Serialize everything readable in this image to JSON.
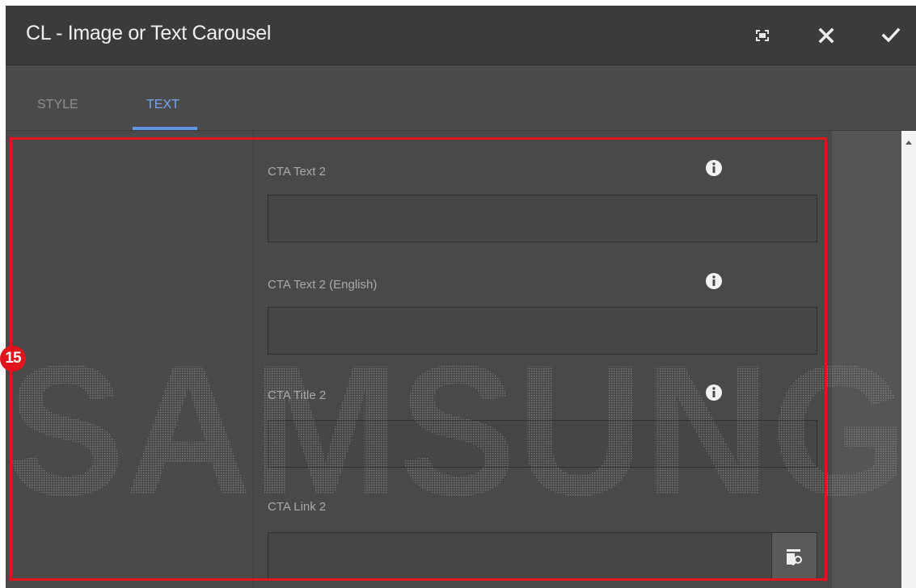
{
  "dialog": {
    "title": "CL - Image or Text Carousel",
    "buttons": [
      {
        "name": "fullscreen",
        "icon": "fullscreen-icon"
      },
      {
        "name": "close",
        "icon": "close-icon"
      },
      {
        "name": "done",
        "icon": "checkmark-icon"
      }
    ]
  },
  "tabs": [
    {
      "label": "STYLE",
      "active": false
    },
    {
      "label": "TEXT",
      "active": true
    }
  ],
  "fields": [
    {
      "label": "CTA Text 2",
      "value": "",
      "icon": "info-icon"
    },
    {
      "label": "CTA Text 2 (English)",
      "value": "",
      "icon": "info-icon"
    },
    {
      "label": "CTA Title 2",
      "value": "",
      "icon": "info-icon"
    },
    {
      "label": "CTA Link 2",
      "value": "",
      "action_icon": "path-browser-icon"
    }
  ],
  "annotation": {
    "badge": "15",
    "highlight_color": "#e0161e"
  },
  "watermark": {
    "text": "SAMSUNG"
  },
  "colors": {
    "accent": "#5f95e6",
    "active_tab_text": "#78a6ec",
    "title_bar": "#3b3b3b",
    "panel": "#4b4b4b"
  }
}
